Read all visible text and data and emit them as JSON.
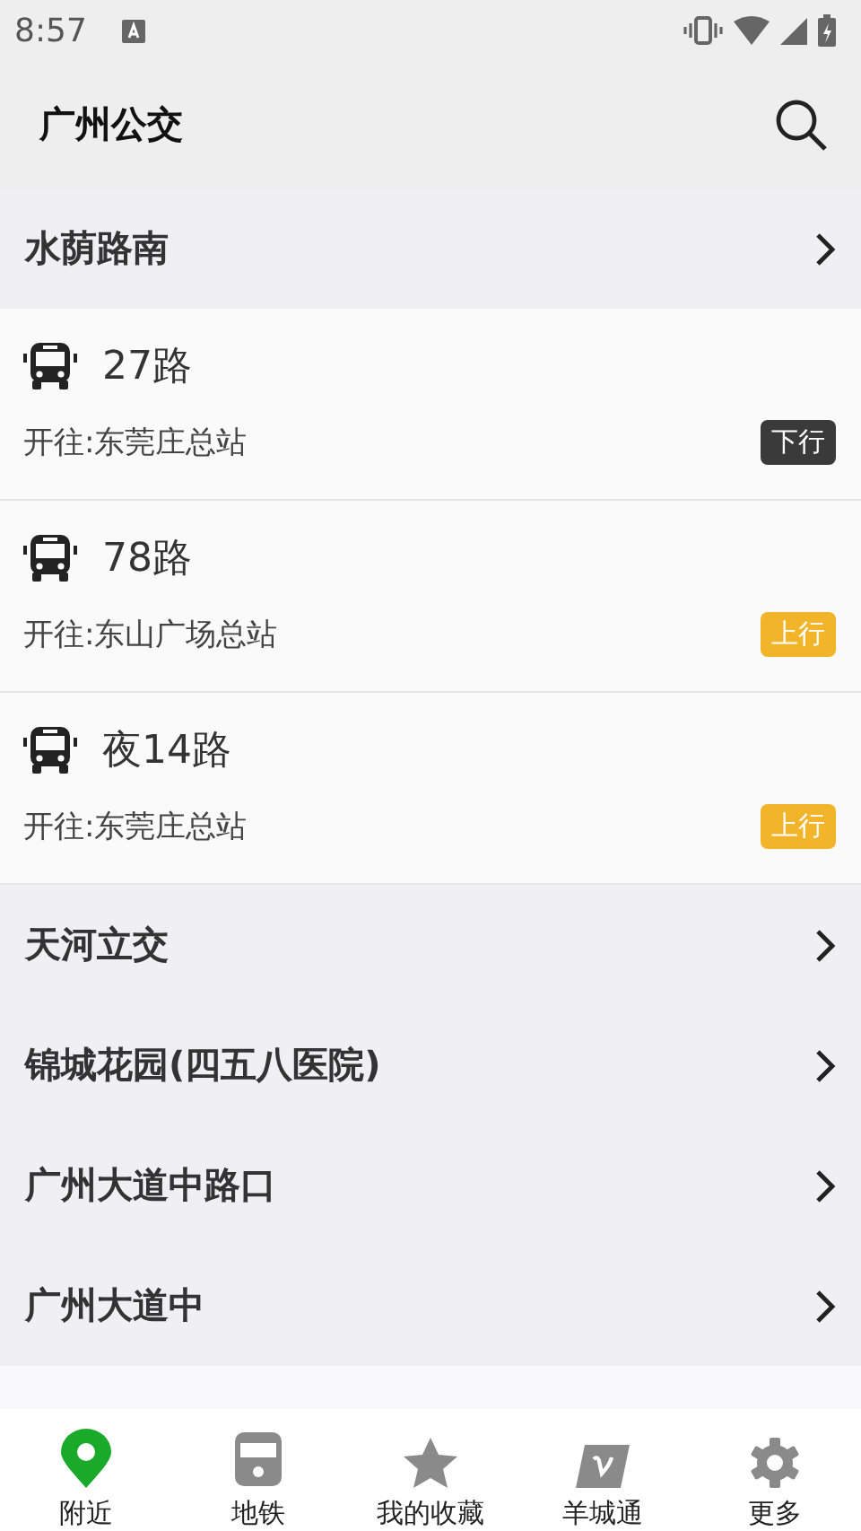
{
  "status_bar": {
    "time": "8:57"
  },
  "app_bar": {
    "title": "广州公交"
  },
  "items": [
    {
      "kind": "stop",
      "name": "水荫路南"
    },
    {
      "kind": "route",
      "name": "27路",
      "destination": "开往:东莞庄总站",
      "direction": {
        "text": "下行",
        "kind": "down"
      }
    },
    {
      "kind": "route",
      "name": "78路",
      "destination": "开往:东山广场总站",
      "direction": {
        "text": "上行",
        "kind": "up"
      }
    },
    {
      "kind": "route",
      "name": "夜14路",
      "destination": "开往:东莞庄总站",
      "direction": {
        "text": "上行",
        "kind": "up"
      }
    },
    {
      "kind": "stop",
      "name": "天河立交"
    },
    {
      "kind": "stop",
      "name": "锦城花园(四五八医院)"
    },
    {
      "kind": "stop",
      "name": "广州大道中路口"
    },
    {
      "kind": "stop",
      "name": "广州大道中"
    }
  ],
  "bottom_nav": [
    {
      "label": "附近",
      "kind": "pin",
      "selected": true
    },
    {
      "label": "地铁",
      "kind": "train",
      "selected": false
    },
    {
      "label": "我的收藏",
      "kind": "star",
      "selected": false
    },
    {
      "label": "羊城通",
      "kind": "card",
      "selected": false
    },
    {
      "label": "更多",
      "kind": "gear",
      "selected": false
    }
  ]
}
